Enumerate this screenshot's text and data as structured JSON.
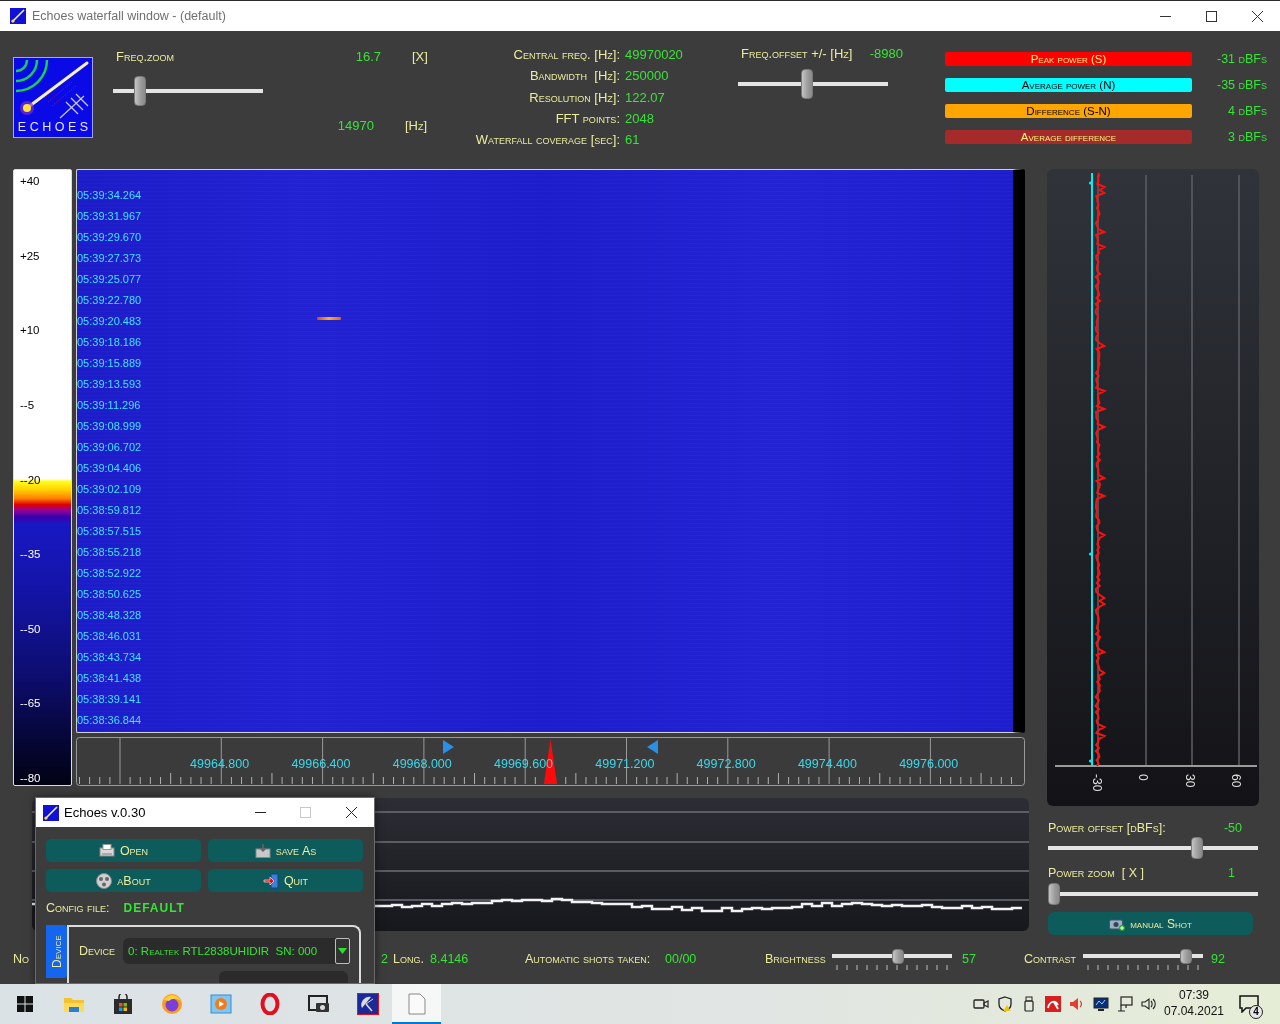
{
  "window": {
    "title": "Echoes waterfall window - (default)"
  },
  "logo": {
    "text": "ECHOES"
  },
  "freq_zoom": {
    "label": "Freq.zoom",
    "value": "16.7",
    "unit": "[X]",
    "level": 0.15,
    "hz_value": "14970",
    "hz_unit": "[Hz]"
  },
  "info": [
    {
      "label": "Central freq. [Hz]:",
      "value": "49970020"
    },
    {
      "label": "Bandwidth  [Hz]:",
      "value": "250000"
    },
    {
      "label": "Resolution [Hz]:",
      "value": "122.07"
    },
    {
      "label": "FFT points:",
      "value": "2048"
    },
    {
      "label": "Waterfall coverage [sec]:",
      "value": "61"
    }
  ],
  "freq_offset": {
    "label": "Freq.offset +/- [Hz]",
    "value": "-8980",
    "level": 0.46
  },
  "legend": [
    {
      "label": "Peak power (S)",
      "color": "#ff0000",
      "value": "-31 dBFs"
    },
    {
      "label": "Average power (N)",
      "color": "#00ffff",
      "value": "-35 dBFs"
    },
    {
      "label": "Difference (S-N)",
      "color": "#ffa500",
      "value": "4 dBFs"
    },
    {
      "label": "Average difference",
      "color": "#a52a2a",
      "value": "3 dBFs"
    }
  ],
  "color_scale": {
    "labels": [
      "+40",
      "+25",
      "+10",
      "--5",
      "--20",
      "--35",
      "--50",
      "--65",
      "--80"
    ]
  },
  "waterfall": {
    "timestamps": [
      "05:39:34.264",
      "05:39:31.967",
      "05:39:29.670",
      "05:39:27.373",
      "05:39:25.077",
      "05:39:22.780",
      "05:39:20.483",
      "05:39:18.186",
      "05:39:15.889",
      "05:39:13.593",
      "05:39:11.296",
      "05:39:08.999",
      "05:39:06.702",
      "05:39:04.406",
      "05:39:02.109",
      "05:38:59.812",
      "05:38:57.515",
      "05:38:55.218",
      "05:38:52.922",
      "05:38:50.625",
      "05:38:48.328",
      "05:38:46.031",
      "05:38:43.734",
      "05:38:41.438",
      "05:38:39.141",
      "05:38:36.844"
    ]
  },
  "frequency_axis": {
    "labels": [
      "49964.800",
      "49966.400",
      "49968.000",
      "49969.600",
      "49971.200",
      "49972.800",
      "49974.400",
      "49976.000"
    ]
  },
  "power_chart": {
    "axis_labels": [
      "-30",
      "0",
      "30",
      "60"
    ]
  },
  "power_offset": {
    "label": "Power offset [dBFs]:",
    "value": "-50",
    "level": 0.72
  },
  "power_zoom": {
    "label": "Power zoom  [ X ]",
    "value": "1",
    "level": 0
  },
  "manual_shot": {
    "label": "manual Shot"
  },
  "status_bar": {
    "left_text": "No",
    "cut_text": "2",
    "longitude_label": "Long.",
    "longitude": "8.4146",
    "shots_label": "Automatic shots taken:",
    "shots": "00/00",
    "brightness": {
      "label": "Brightness",
      "value": "57",
      "level": 0.56
    },
    "contrast": {
      "label": "Contrast",
      "value": "92",
      "level": 0.9
    }
  },
  "dialog": {
    "title": "Echoes v.0.30",
    "buttons": [
      "Open",
      "save As",
      "aBout",
      "Quit"
    ],
    "config_label": "Config file:",
    "config_value": "DEFAULT",
    "tabs": [
      {
        "label": "Device",
        "selected": true
      }
    ],
    "device": {
      "label": "Device",
      "value": "0: Realtek RTL2838UHIDIR  SN: 000"
    }
  },
  "taskbar": {
    "apps": [
      {
        "selected": false
      },
      {
        "selected": false
      },
      {
        "selected": false
      },
      {
        "selected": false
      },
      {
        "selected": false
      },
      {
        "selected": false
      },
      {
        "selected": false
      },
      {
        "selected": true
      }
    ],
    "time": "07:39",
    "date": "07.04.2021",
    "notifications": "4"
  }
}
